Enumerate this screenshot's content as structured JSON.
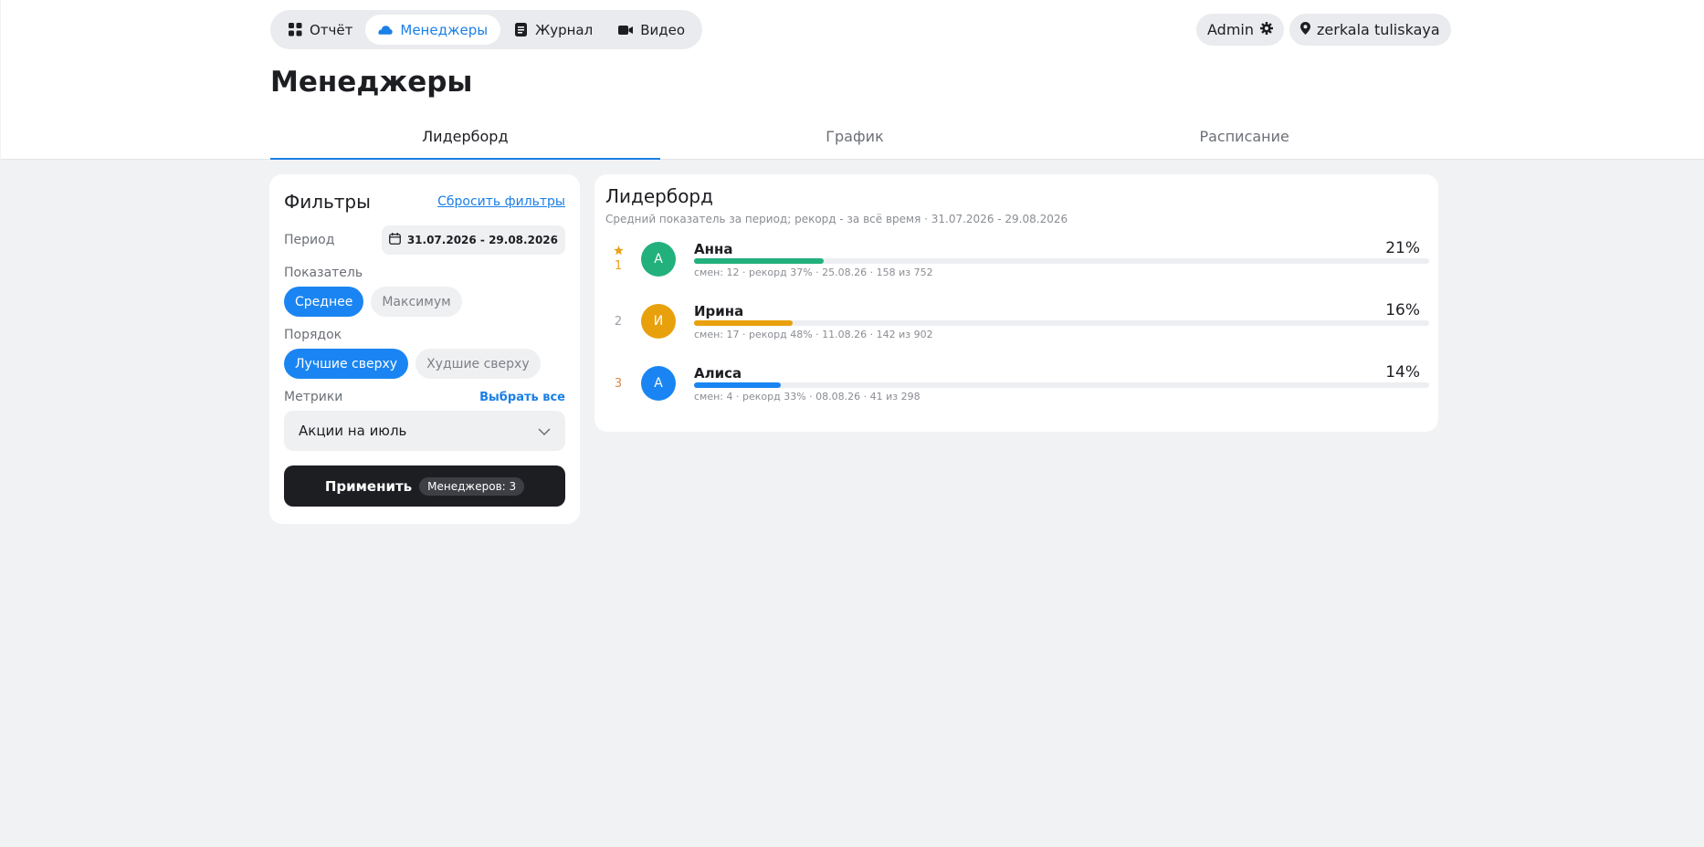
{
  "nav": {
    "items": [
      {
        "label": "Отчёт",
        "icon": "grid-icon"
      },
      {
        "label": "Менеджеры",
        "icon": "cloud-icon"
      },
      {
        "label": "Журнал",
        "icon": "journal-icon"
      },
      {
        "label": "Видео",
        "icon": "video-icon"
      }
    ],
    "active_index": 1
  },
  "account": {
    "user_label": "Admin",
    "location_label": "zerkala tuliskaya"
  },
  "page": {
    "title": "Менеджеры"
  },
  "tabs": [
    {
      "label": "Лидерборд",
      "active": true
    },
    {
      "label": "График",
      "active": false
    },
    {
      "label": "Расписание",
      "active": false
    }
  ],
  "filters": {
    "title": "Фильтры",
    "reset_label": "Сбросить фильтры",
    "period_label": "Период",
    "period_value": "31.07.2026 - 29.08.2026",
    "indicator_label": "Показатель",
    "indicator_options": [
      "Среднее",
      "Максимум"
    ],
    "indicator_selected": 0,
    "order_label": "Порядок",
    "order_options": [
      "Лучшие сверху",
      "Худшие сверху"
    ],
    "order_selected": 0,
    "metrics_label": "Метрики",
    "select_all_label": "Выбрать все",
    "metrics_value": "Акции на июль",
    "apply_label": "Применить",
    "apply_badge": "Менеджеров: 3"
  },
  "leaderboard": {
    "title": "Лидерборд",
    "subtitle": "Средний показатель за период; рекорд - за всё время · 31.07.2026 - 29.08.2026",
    "entries": [
      {
        "rank": "1",
        "initial": "А",
        "name": "Анна",
        "percent_label": "21%",
        "percent": 21,
        "meta": "смен: 12 · рекорд 37% · 25.08.26 · 158 из 752",
        "color": "#22b07d",
        "star": true,
        "rank_color": "#e6a21a"
      },
      {
        "rank": "2",
        "initial": "И",
        "name": "Ирина",
        "percent_label": "16%",
        "percent": 16,
        "meta": "смен: 17 · рекорд 48% · 11.08.26 · 142 из 902",
        "color": "#e8a10c",
        "star": false,
        "rank_color": "#9aa0a8"
      },
      {
        "rank": "3",
        "initial": "А",
        "name": "Алиса",
        "percent_label": "14%",
        "percent": 14,
        "meta": "смен: 4 · рекорд 33% · 08.08.26 · 41 из 298",
        "color": "#1a85f2",
        "star": false,
        "rank_color": "#d7884a"
      }
    ]
  },
  "colors": {
    "accent": "#1a85f2",
    "dark": "#1d1e22",
    "background": "#f1f2f4"
  }
}
